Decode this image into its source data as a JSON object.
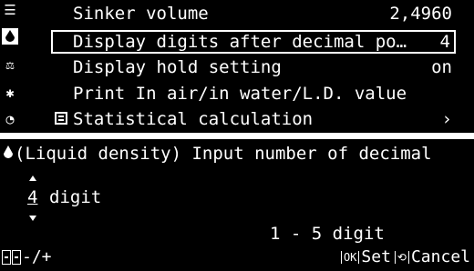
{
  "top_panel": {
    "nav_icons": [
      {
        "icon": "menu-icon",
        "glyph": "☰",
        "active": false
      },
      {
        "icon": "density-drop-icon",
        "glyph": "🜄",
        "active": true
      },
      {
        "icon": "specific-gravity-icon",
        "glyph": "⚖",
        "active": false
      },
      {
        "icon": "settings-gear-icon",
        "glyph": "✱",
        "active": false
      },
      {
        "icon": "clock-settings-icon",
        "glyph": "◔",
        "active": false
      }
    ],
    "rows": [
      {
        "label": "Sinker volume",
        "value": "2,4960"
      },
      {
        "label": "Display digits after decimal po…",
        "value": "4"
      },
      {
        "label": "Display hold setting",
        "value": "on"
      },
      {
        "label": "Print   In air/in water/L.D. value",
        "value": ""
      },
      {
        "label": "Statistical calculation",
        "value": "›"
      }
    ]
  },
  "dialog": {
    "title": "(Liquid density) Input number of decimal",
    "title_icon": "liquid-drop-icon",
    "value": "4",
    "unit": "digit",
    "range": "1 - 5 digit",
    "adjust_label": "-/+",
    "ok_key": "OK",
    "ok_label": "Set",
    "cancel_key": "⟲",
    "cancel_label": "Cancel"
  }
}
